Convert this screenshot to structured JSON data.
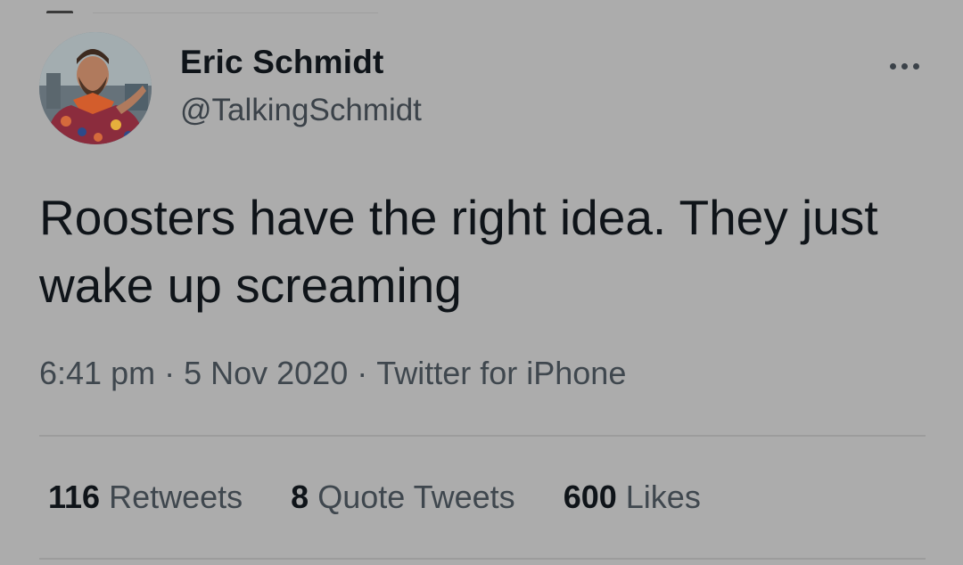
{
  "author": {
    "display_name": "Eric Schmidt",
    "handle": "@TalkingSchmidt"
  },
  "tweet": {
    "text": "Roosters have the right idea. They just wake up screaming"
  },
  "meta": {
    "time": "6:41 pm",
    "date": "5 Nov 2020",
    "separator": "·",
    "source": "Twitter for iPhone"
  },
  "stats": {
    "retweets_count": "116",
    "retweets_label": "Retweets",
    "quote_tweets_count": "8",
    "quote_tweets_label": "Quote Tweets",
    "likes_count": "600",
    "likes_label": "Likes"
  },
  "icons": {
    "more": "more-horizontal-icon"
  },
  "colors": {
    "background": "#acacac",
    "primary_text": "#0f1419",
    "secondary_text": "#3f474e",
    "divider": "#9c9c9c"
  }
}
